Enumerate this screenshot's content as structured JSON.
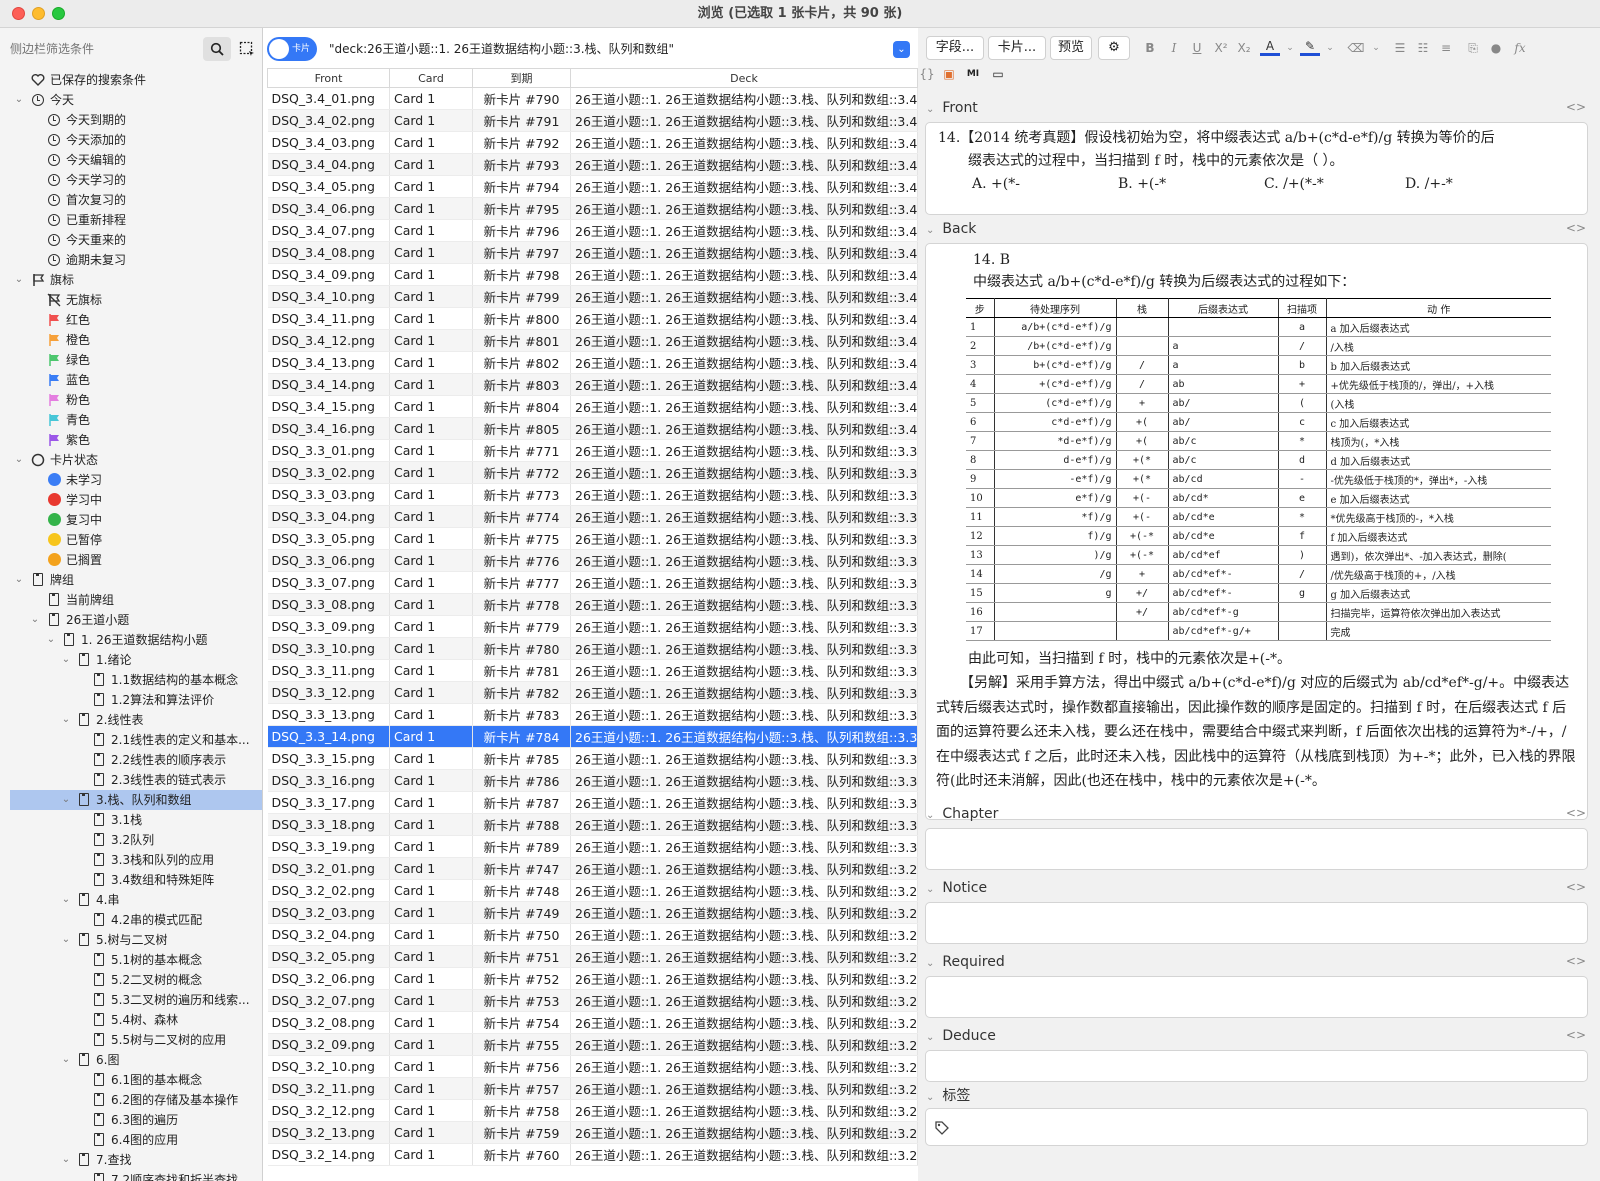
{
  "window": {
    "title": "浏览 (已选取 1 张卡片，共 90 张)"
  },
  "sidebar": {
    "search_placeholder": "侧边栏筛选条件",
    "saved": "已保存的搜索条件",
    "today": {
      "label": "今天",
      "items": [
        "今天到期的",
        "今天添加的",
        "今天编辑的",
        "今天学习的",
        "首次复习的",
        "已重新排程",
        "今天重来的",
        "逾期未复习"
      ]
    },
    "flags": {
      "label": "旗标",
      "items": [
        {
          "label": "无旗标",
          "color": "#333333"
        },
        {
          "label": "红色",
          "color": "#f0504f"
        },
        {
          "label": "橙色",
          "color": "#f6a03a"
        },
        {
          "label": "绿色",
          "color": "#4dc66e"
        },
        {
          "label": "蓝色",
          "color": "#3a7df5"
        },
        {
          "label": "粉色",
          "color": "#e47ee0"
        },
        {
          "label": "青色",
          "color": "#47c6d7"
        },
        {
          "label": "紫色",
          "color": "#9b57e8"
        }
      ]
    },
    "states": {
      "label": "卡片状态",
      "items": [
        {
          "label": "未学习",
          "color": "#3a7df5"
        },
        {
          "label": "学习中",
          "color": "#e8382f"
        },
        {
          "label": "复习中",
          "color": "#34b34a"
        },
        {
          "label": "已暂停",
          "color": "#f7c51c"
        },
        {
          "label": "已搁置",
          "color": "#f3a21c"
        }
      ]
    },
    "decks": {
      "label": "牌组",
      "current": "当前牌组",
      "root": "26王道小题",
      "sub": "1. 26王道数据结构小题",
      "chapters": [
        {
          "label": "1.绪论",
          "items": [
            "1.1数据结构的基本概念",
            "1.2算法和算法评价"
          ]
        },
        {
          "label": "2.线性表",
          "items": [
            "2.1线性表的定义和基本...",
            "2.2线性表的顺序表示",
            "2.3线性表的链式表示"
          ]
        },
        {
          "label": "3.栈、队列和数组",
          "items": [
            "3.1栈",
            "3.2队列",
            "3.3栈和队列的应用",
            "3.4数组和特殊矩阵"
          ]
        },
        {
          "label": "4.串",
          "items": [
            "4.2串的模式匹配"
          ]
        },
        {
          "label": "5.树与二叉树",
          "items": [
            "5.1树的基本概念",
            "5.2二叉树的概念",
            "5.3二叉树的遍历和线索...",
            "5.4树、森林",
            "5.5树与二叉树的应用"
          ]
        },
        {
          "label": "6.图",
          "items": [
            "6.1图的基本概念",
            "6.2图的存储及基本操作",
            "6.3图的遍历",
            "6.4图的应用"
          ]
        },
        {
          "label": "7.查找",
          "items": [
            "7.2顺序查找和折半查找"
          ]
        }
      ]
    }
  },
  "browser": {
    "toggle_label": "卡片",
    "query": "\"deck:26王道小题::1. 26王道数据结构小题::3.栈、队列和数组\"",
    "columns": [
      "Front",
      "Card",
      "到期",
      "Deck"
    ],
    "rows": [
      [
        "DSQ_3.4_01.png",
        "Card 1",
        "新卡片 #790",
        "26王道小题::1. 26王道数据结构小题::3.栈、队列和数组::3.4"
      ],
      [
        "DSQ_3.4_02.png",
        "Card 1",
        "新卡片 #791",
        "26王道小题::1. 26王道数据结构小题::3.栈、队列和数组::3.4"
      ],
      [
        "DSQ_3.4_03.png",
        "Card 1",
        "新卡片 #792",
        "26王道小题::1. 26王道数据结构小题::3.栈、队列和数组::3.4"
      ],
      [
        "DSQ_3.4_04.png",
        "Card 1",
        "新卡片 #793",
        "26王道小题::1. 26王道数据结构小题::3.栈、队列和数组::3.4"
      ],
      [
        "DSQ_3.4_05.png",
        "Card 1",
        "新卡片 #794",
        "26王道小题::1. 26王道数据结构小题::3.栈、队列和数组::3.4"
      ],
      [
        "DSQ_3.4_06.png",
        "Card 1",
        "新卡片 #795",
        "26王道小题::1. 26王道数据结构小题::3.栈、队列和数组::3.4"
      ],
      [
        "DSQ_3.4_07.png",
        "Card 1",
        "新卡片 #796",
        "26王道小题::1. 26王道数据结构小题::3.栈、队列和数组::3.4"
      ],
      [
        "DSQ_3.4_08.png",
        "Card 1",
        "新卡片 #797",
        "26王道小题::1. 26王道数据结构小题::3.栈、队列和数组::3.4"
      ],
      [
        "DSQ_3.4_09.png",
        "Card 1",
        "新卡片 #798",
        "26王道小题::1. 26王道数据结构小题::3.栈、队列和数组::3.4"
      ],
      [
        "DSQ_3.4_10.png",
        "Card 1",
        "新卡片 #799",
        "26王道小题::1. 26王道数据结构小题::3.栈、队列和数组::3.4"
      ],
      [
        "DSQ_3.4_11.png",
        "Card 1",
        "新卡片 #800",
        "26王道小题::1. 26王道数据结构小题::3.栈、队列和数组::3.4"
      ],
      [
        "DSQ_3.4_12.png",
        "Card 1",
        "新卡片 #801",
        "26王道小题::1. 26王道数据结构小题::3.栈、队列和数组::3.4"
      ],
      [
        "DSQ_3.4_13.png",
        "Card 1",
        "新卡片 #802",
        "26王道小题::1. 26王道数据结构小题::3.栈、队列和数组::3.4"
      ],
      [
        "DSQ_3.4_14.png",
        "Card 1",
        "新卡片 #803",
        "26王道小题::1. 26王道数据结构小题::3.栈、队列和数组::3.4"
      ],
      [
        "DSQ_3.4_15.png",
        "Card 1",
        "新卡片 #804",
        "26王道小题::1. 26王道数据结构小题::3.栈、队列和数组::3.4"
      ],
      [
        "DSQ_3.4_16.png",
        "Card 1",
        "新卡片 #805",
        "26王道小题::1. 26王道数据结构小题::3.栈、队列和数组::3.4"
      ],
      [
        "DSQ_3.3_01.png",
        "Card 1",
        "新卡片 #771",
        "26王道小题::1. 26王道数据结构小题::3.栈、队列和数组::3.3"
      ],
      [
        "DSQ_3.3_02.png",
        "Card 1",
        "新卡片 #772",
        "26王道小题::1. 26王道数据结构小题::3.栈、队列和数组::3.3"
      ],
      [
        "DSQ_3.3_03.png",
        "Card 1",
        "新卡片 #773",
        "26王道小题::1. 26王道数据结构小题::3.栈、队列和数组::3.3"
      ],
      [
        "DSQ_3.3_04.png",
        "Card 1",
        "新卡片 #774",
        "26王道小题::1. 26王道数据结构小题::3.栈、队列和数组::3.3"
      ],
      [
        "DSQ_3.3_05.png",
        "Card 1",
        "新卡片 #775",
        "26王道小题::1. 26王道数据结构小题::3.栈、队列和数组::3.3"
      ],
      [
        "DSQ_3.3_06.png",
        "Card 1",
        "新卡片 #776",
        "26王道小题::1. 26王道数据结构小题::3.栈、队列和数组::3.3"
      ],
      [
        "DSQ_3.3_07.png",
        "Card 1",
        "新卡片 #777",
        "26王道小题::1. 26王道数据结构小题::3.栈、队列和数组::3.3"
      ],
      [
        "DSQ_3.3_08.png",
        "Card 1",
        "新卡片 #778",
        "26王道小题::1. 26王道数据结构小题::3.栈、队列和数组::3.3"
      ],
      [
        "DSQ_3.3_09.png",
        "Card 1",
        "新卡片 #779",
        "26王道小题::1. 26王道数据结构小题::3.栈、队列和数组::3.3"
      ],
      [
        "DSQ_3.3_10.png",
        "Card 1",
        "新卡片 #780",
        "26王道小题::1. 26王道数据结构小题::3.栈、队列和数组::3.3"
      ],
      [
        "DSQ_3.3_11.png",
        "Card 1",
        "新卡片 #781",
        "26王道小题::1. 26王道数据结构小题::3.栈、队列和数组::3.3"
      ],
      [
        "DSQ_3.3_12.png",
        "Card 1",
        "新卡片 #782",
        "26王道小题::1. 26王道数据结构小题::3.栈、队列和数组::3.3"
      ],
      [
        "DSQ_3.3_13.png",
        "Card 1",
        "新卡片 #783",
        "26王道小题::1. 26王道数据结构小题::3.栈、队列和数组::3.3"
      ],
      [
        "DSQ_3.3_14.png",
        "Card 1",
        "新卡片 #784",
        "26王道小题::1. 26王道数据结构小题::3.栈、队列和数组::3.3"
      ],
      [
        "DSQ_3.3_15.png",
        "Card 1",
        "新卡片 #785",
        "26王道小题::1. 26王道数据结构小题::3.栈、队列和数组::3.3"
      ],
      [
        "DSQ_3.3_16.png",
        "Card 1",
        "新卡片 #786",
        "26王道小题::1. 26王道数据结构小题::3.栈、队列和数组::3.3"
      ],
      [
        "DSQ_3.3_17.png",
        "Card 1",
        "新卡片 #787",
        "26王道小题::1. 26王道数据结构小题::3.栈、队列和数组::3.3"
      ],
      [
        "DSQ_3.3_18.png",
        "Card 1",
        "新卡片 #788",
        "26王道小题::1. 26王道数据结构小题::3.栈、队列和数组::3.3"
      ],
      [
        "DSQ_3.3_19.png",
        "Card 1",
        "新卡片 #789",
        "26王道小题::1. 26王道数据结构小题::3.栈、队列和数组::3.3"
      ],
      [
        "DSQ_3.2_01.png",
        "Card 1",
        "新卡片 #747",
        "26王道小题::1. 26王道数据结构小题::3.栈、队列和数组::3.2"
      ],
      [
        "DSQ_3.2_02.png",
        "Card 1",
        "新卡片 #748",
        "26王道小题::1. 26王道数据结构小题::3.栈、队列和数组::3.2"
      ],
      [
        "DSQ_3.2_03.png",
        "Card 1",
        "新卡片 #749",
        "26王道小题::1. 26王道数据结构小题::3.栈、队列和数组::3.2"
      ],
      [
        "DSQ_3.2_04.png",
        "Card 1",
        "新卡片 #750",
        "26王道小题::1. 26王道数据结构小题::3.栈、队列和数组::3.2"
      ],
      [
        "DSQ_3.2_05.png",
        "Card 1",
        "新卡片 #751",
        "26王道小题::1. 26王道数据结构小题::3.栈、队列和数组::3.2"
      ],
      [
        "DSQ_3.2_06.png",
        "Card 1",
        "新卡片 #752",
        "26王道小题::1. 26王道数据结构小题::3.栈、队列和数组::3.2"
      ],
      [
        "DSQ_3.2_07.png",
        "Card 1",
        "新卡片 #753",
        "26王道小题::1. 26王道数据结构小题::3.栈、队列和数组::3.2"
      ],
      [
        "DSQ_3.2_08.png",
        "Card 1",
        "新卡片 #754",
        "26王道小题::1. 26王道数据结构小题::3.栈、队列和数组::3.2"
      ],
      [
        "DSQ_3.2_09.png",
        "Card 1",
        "新卡片 #755",
        "26王道小题::1. 26王道数据结构小题::3.栈、队列和数组::3.2"
      ],
      [
        "DSQ_3.2_10.png",
        "Card 1",
        "新卡片 #756",
        "26王道小题::1. 26王道数据结构小题::3.栈、队列和数组::3.2"
      ],
      [
        "DSQ_3.2_11.png",
        "Card 1",
        "新卡片 #757",
        "26王道小题::1. 26王道数据结构小题::3.栈、队列和数组::3.2"
      ],
      [
        "DSQ_3.2_12.png",
        "Card 1",
        "新卡片 #758",
        "26王道小题::1. 26王道数据结构小题::3.栈、队列和数组::3.2"
      ],
      [
        "DSQ_3.2_13.png",
        "Card 1",
        "新卡片 #759",
        "26王道小题::1. 26王道数据结构小题::3.栈、队列和数组::3.2"
      ],
      [
        "DSQ_3.2_14.png",
        "Card 1",
        "新卡片 #760",
        "26王道小题::1. 26王道数据结构小题::3.栈、队列和数组::3.2"
      ]
    ],
    "selected_index": 29
  },
  "editor": {
    "toolbar": {
      "fields": "字段...",
      "cards": "卡片...",
      "preview": "预览",
      "mi_label": "MI"
    },
    "fields": {
      "front_label": "Front",
      "back_label": "Back",
      "chapter_label": "Chapter",
      "notice_label": "Notice",
      "required_label": "Required",
      "deduce_label": "Deduce",
      "tags_label": "标签"
    },
    "front": {
      "line1": "14.【2014 统考真题】假设栈初始为空，将中缀表达式 a/b+(c*d-e*f)/g 转换为等价的后",
      "line2": "缀表达式的过程中，当扫描到 f 时，栈中的元素依次是（  ）。",
      "options": [
        "A.  +(*-",
        "B.  +(-*",
        "C.  /+(*-*",
        "D.  /+-*"
      ]
    },
    "back": {
      "answer": "14.  B",
      "intro": "中缀表达式 a/b+(c*d-e*f)/g 转换为后缀表达式的过程如下：",
      "table_headers": [
        "步",
        "待处理序列",
        "栈",
        "后缀表达式",
        "扫描项",
        "动    作"
      ],
      "table_rows": [
        [
          "1",
          "a/b+(c*d-e*f)/g",
          "",
          "",
          "a",
          "a 加入后缀表达式"
        ],
        [
          "2",
          "/b+(c*d-e*f)/g",
          "",
          "a",
          "/",
          "/入栈"
        ],
        [
          "3",
          "b+(c*d-e*f)/g",
          "/",
          "a",
          "b",
          "b 加入后缀表达式"
        ],
        [
          "4",
          "+(c*d-e*f)/g",
          "/",
          "ab",
          "+",
          "+优先级低于栈顶的/，弹出/，+入栈"
        ],
        [
          "5",
          "(c*d-e*f)/g",
          "+",
          "ab/",
          "(",
          "(入栈"
        ],
        [
          "6",
          "c*d-e*f)/g",
          "+(",
          "ab/",
          "c",
          "c 加入后缀表达式"
        ],
        [
          "7",
          "*d-e*f)/g",
          "+(",
          "ab/c",
          "*",
          "栈顶为(，*入栈"
        ],
        [
          "8",
          "d-e*f)/g",
          "+(*",
          "ab/c",
          "d",
          "d 加入后缀表达式"
        ],
        [
          "9",
          "-e*f)/g",
          "+(*",
          "ab/cd",
          "-",
          "-优先级低于栈顶的*，弹出*，-入栈"
        ],
        [
          "10",
          "e*f)/g",
          "+(-",
          "ab/cd*",
          "e",
          "e 加入后缀表达式"
        ],
        [
          "11",
          "*f)/g",
          "+(-",
          "ab/cd*e",
          "*",
          "*优先级高于栈顶的-，*入栈"
        ],
        [
          "12",
          "f)/g",
          "+(-*",
          "ab/cd*e",
          "f",
          "f 加入后缀表达式"
        ],
        [
          "13",
          ")/g",
          "+(-*",
          "ab/cd*ef",
          ")",
          "遇到)，依次弹出*、-加入表达式，删除("
        ],
        [
          "14",
          "/g",
          "+",
          "ab/cd*ef*-",
          "/",
          "/优先级高于栈顶的+，/入栈"
        ],
        [
          "15",
          "g",
          "+/",
          "ab/cd*ef*-",
          "g",
          "g 加入后缀表达式"
        ],
        [
          "16",
          "",
          "+/",
          "ab/cd*ef*-g",
          "",
          "扫描完毕，运算符依次弹出加入表达式"
        ],
        [
          "17",
          "",
          "",
          "ab/cd*ef*-g/+",
          "",
          "完成"
        ]
      ],
      "conclusion": "由此可知，当扫描到 f 时，栈中的元素依次是+(-*。",
      "alt": "【另解】采用手算方法，得出中缀式 a/b+(c*d-e*f)/g 对应的后缀式为 ab/cd*ef*-g/+。中缀表达式转后缀表达式时，操作数都直接输出，因此操作数的顺序是固定的。扫描到 f 时，在后缀表达式 f 后面的运算符要么还未入栈，要么还在栈中，需要结合中缀式来判断，f 后面依次出栈的运算符为*-/+，/在中缀表达式 f 之后，此时还未入栈，因此栈中的运算符（从栈底到栈顶）为+-*；此外，已入栈的界限符(此时还未消解，因此(也还在栈中，栈中的元素依次是+(-*。"
    }
  }
}
